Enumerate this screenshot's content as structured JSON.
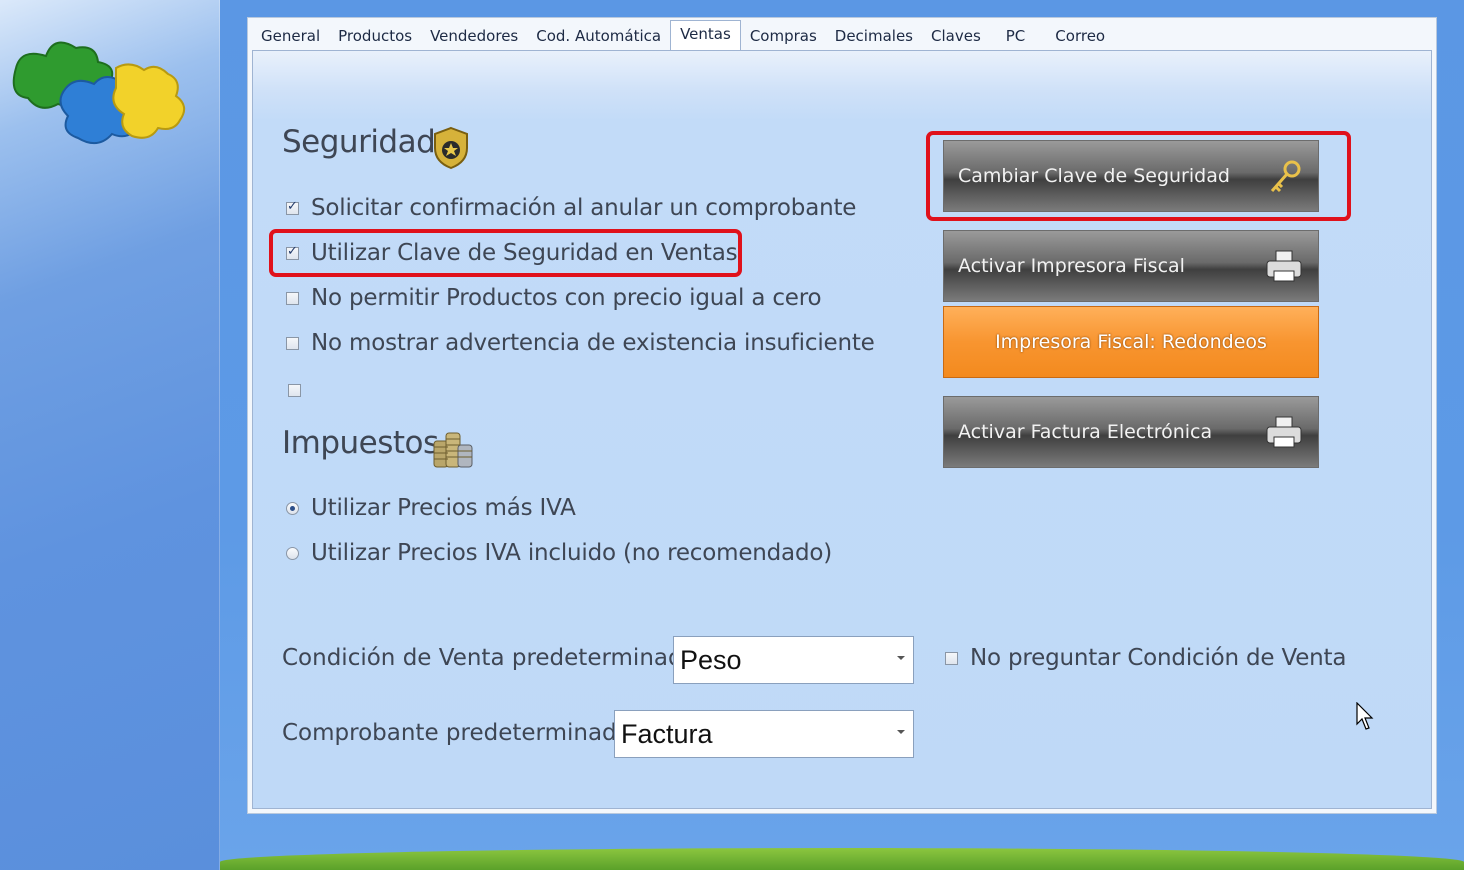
{
  "tabs": [
    "General",
    "Productos",
    "Vendedores",
    "Cod. Automática",
    "Ventas",
    "Compras",
    "Decimales",
    "Claves",
    "PC",
    "Correo"
  ],
  "active_tab": "Ventas",
  "seguridad": {
    "heading": "Seguridad",
    "icon": "police-badge-icon",
    "options": [
      {
        "label": "Solicitar confirmación al anular un comprobante",
        "checked": true
      },
      {
        "label": "Utilizar Clave de Seguridad en Ventas",
        "checked": true
      },
      {
        "label": "No permitir Productos con precio igual a cero",
        "checked": false
      },
      {
        "label": "No mostrar advertencia de existencia insuficiente",
        "checked": false
      },
      {
        "label": "",
        "checked": false
      }
    ]
  },
  "impuestos": {
    "heading": "Impuestos",
    "icon": "coins-icon",
    "options": [
      {
        "label": "Utilizar Precios más IVA",
        "selected": true
      },
      {
        "label": "Utilizar Precios IVA incluido (no recomendado)",
        "selected": false
      }
    ]
  },
  "buttons": {
    "cambiar_clave": "Cambiar Clave de Seguridad",
    "activar_impresora": "Activar Impresora Fiscal",
    "redondeos": "Impresora Fiscal: Redondeos",
    "factura_electronica": "Activar Factura Electrónica"
  },
  "condicion_venta": {
    "label": "Condición de Venta predeterminada",
    "value": "Peso"
  },
  "comprobante": {
    "label": "Comprobante predeterminado",
    "value": "Factura"
  },
  "no_preguntar": {
    "label": "No preguntar Condición de Venta",
    "checked": false
  },
  "colors": {
    "highlight": "#e0111b",
    "orange_button": "#f89530",
    "panel_bg": "#c2dbf8"
  }
}
